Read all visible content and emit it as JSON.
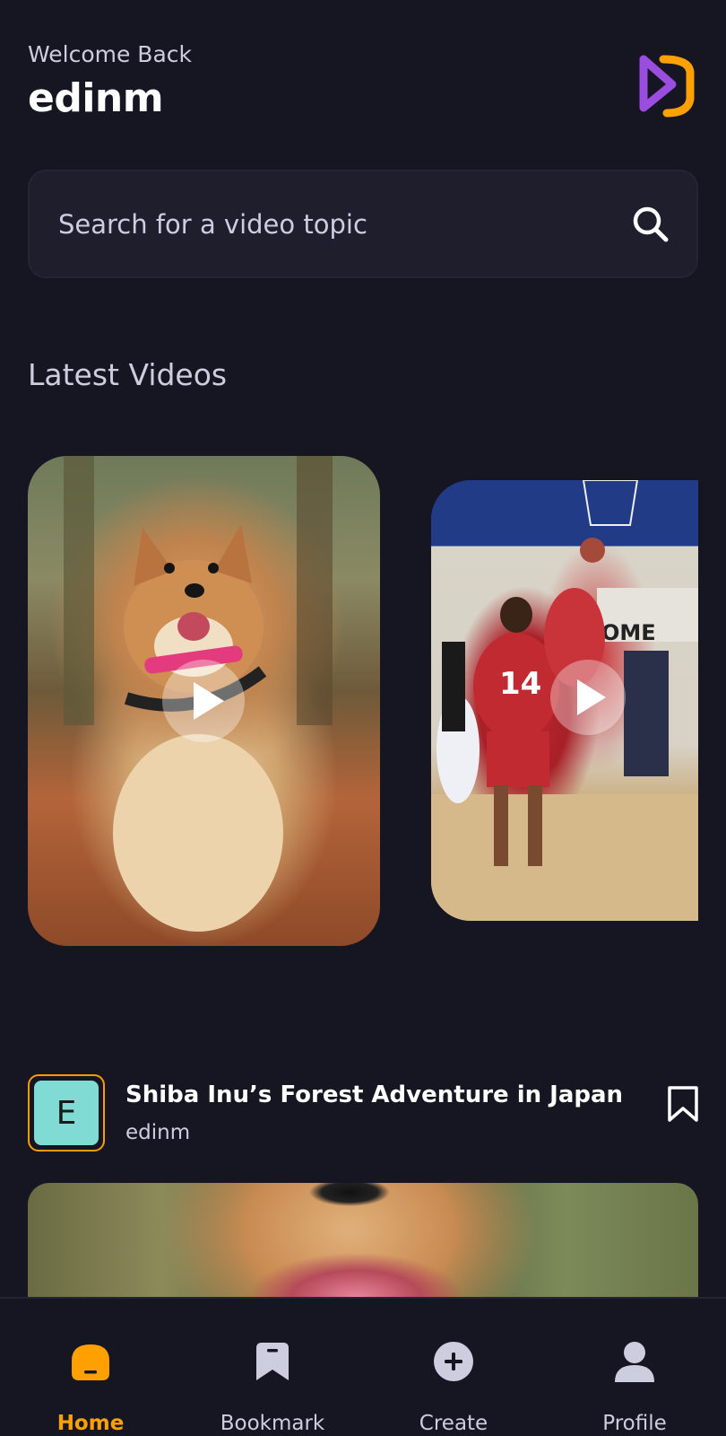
{
  "header": {
    "greeting": "Welcome Back",
    "username": "edinm"
  },
  "search": {
    "placeholder": "Search for a video topic",
    "value": ""
  },
  "latest": {
    "title": "Latest Videos",
    "videos": [
      {
        "subject": "shiba-inu"
      },
      {
        "subject": "basketball"
      }
    ]
  },
  "post": {
    "avatar_letter": "E",
    "title": "Shiba Inu’s Forest Adventure in Japan",
    "author": "edinm"
  },
  "tabs": [
    {
      "label": "Home",
      "icon": "home-icon",
      "active": true
    },
    {
      "label": "Bookmark",
      "icon": "bookmark-icon",
      "active": false
    },
    {
      "label": "Create",
      "icon": "plus-circle-icon",
      "active": false
    },
    {
      "label": "Profile",
      "icon": "profile-icon",
      "active": false
    }
  ],
  "colors": {
    "background": "#161622",
    "surface": "#1E1E2D",
    "accent": "#FFA001",
    "muted_text": "#CDCDE0",
    "logo_purple": "#9B4DE0",
    "logo_orange": "#FFA001"
  }
}
